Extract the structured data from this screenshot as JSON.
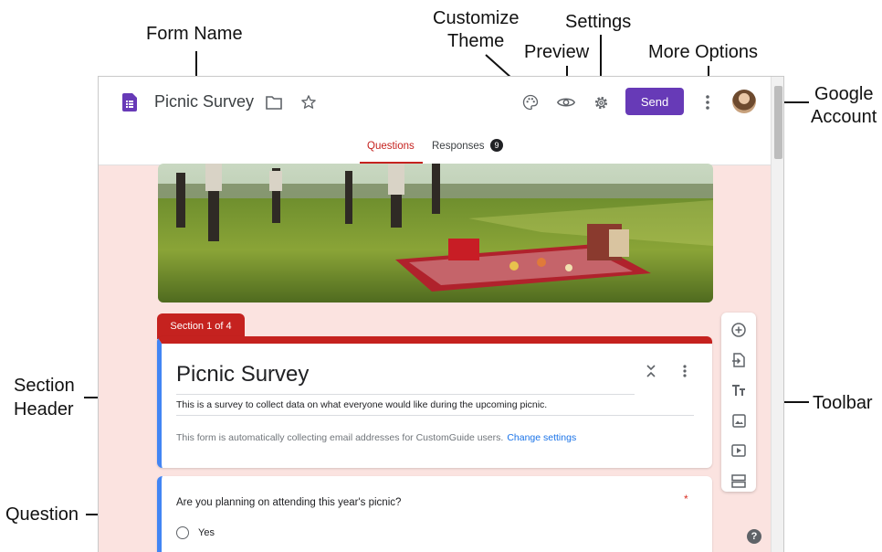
{
  "annotations": {
    "form_name": "Form Name",
    "customize_theme_1": "Customize",
    "customize_theme_2": "Theme",
    "preview": "Preview",
    "settings": "Settings",
    "more_options": "More Options",
    "google_account_1": "Google",
    "google_account_2": "Account",
    "section_header_1": "Section",
    "section_header_2": "Header",
    "toolbar": "Toolbar",
    "question": "Question"
  },
  "header": {
    "form_title": "Picnic Survey",
    "send_label": "Send"
  },
  "tabs": {
    "questions": "Questions",
    "responses": "Responses",
    "responses_count": "9"
  },
  "section": {
    "tab_label": "Section 1 of 4",
    "title": "Picnic Survey",
    "description": "This is a survey to collect data on what everyone would like during the upcoming picnic.",
    "note": "This form is automatically collecting email addresses for CustomGuide users.",
    "note_link": "Change settings"
  },
  "question": {
    "title": "Are you planning on attending this year's picnic?",
    "required_mark": "*",
    "option_1": "Yes"
  },
  "help_label": "?",
  "colors": {
    "accent_purple": "#673ab7",
    "section_red": "#c5221f",
    "section_blue": "#4285f4",
    "page_bg": "#fbe3e0"
  }
}
